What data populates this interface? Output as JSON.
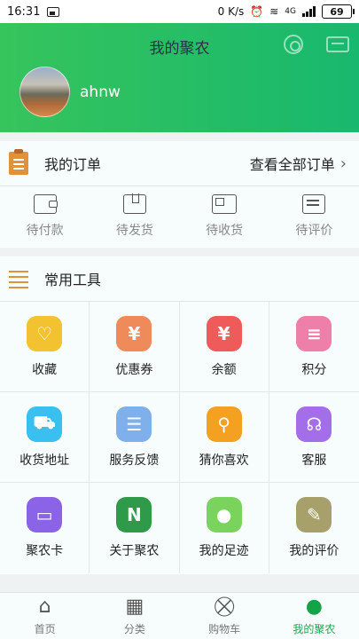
{
  "status_bar": {
    "time": "16:31",
    "net_speed": "0 K/s",
    "network": "4G",
    "battery": "69"
  },
  "header": {
    "title": "我的聚农",
    "username": "ahnw",
    "gradient_start": "#36c45c",
    "gradient_end": "#18b86e"
  },
  "orders": {
    "title": "我的订单",
    "view_all": "查看全部订单",
    "items": [
      {
        "label": "待付款",
        "icon": "wallet-icon"
      },
      {
        "label": "待发货",
        "icon": "box-icon"
      },
      {
        "label": "待收货",
        "icon": "truck-icon"
      },
      {
        "label": "待评价",
        "icon": "comment-icon"
      }
    ]
  },
  "tools": {
    "title": "常用工具",
    "items": [
      {
        "label": "收藏",
        "icon": "heart-icon",
        "color": "#f2c231",
        "glyph": "♡"
      },
      {
        "label": "优惠券",
        "icon": "coupon-icon",
        "color": "#ef8a5a",
        "glyph": "¥"
      },
      {
        "label": "余额",
        "icon": "money-bag-icon",
        "color": "#ef5b5b",
        "glyph": "¥"
      },
      {
        "label": "积分",
        "icon": "coins-icon",
        "color": "#ee7fa8",
        "glyph": "≡"
      },
      {
        "label": "收货地址",
        "icon": "delivery-truck-icon",
        "color": "#39c0f0",
        "glyph": "⛟"
      },
      {
        "label": "服务反馈",
        "icon": "clipboard-icon",
        "color": "#7fb0ec",
        "glyph": "☰"
      },
      {
        "label": "猜你喜欢",
        "icon": "magnifier-icon",
        "color": "#f4a020",
        "glyph": "⚲"
      },
      {
        "label": "客服",
        "icon": "headset-icon",
        "color": "#a46ee8",
        "glyph": "☊"
      },
      {
        "label": "聚农卡",
        "icon": "card-icon",
        "color": "#8a63e6",
        "glyph": "▭"
      },
      {
        "label": "关于聚农",
        "icon": "logo-icon",
        "color": "#2f9a49",
        "glyph": "N"
      },
      {
        "label": "我的足迹",
        "icon": "footprint-icon",
        "color": "#7ad35c",
        "glyph": "●"
      },
      {
        "label": "我的评价",
        "icon": "edit-icon",
        "color": "#a8a06a",
        "glyph": "✎"
      }
    ]
  },
  "tabbar": {
    "items": [
      {
        "label": "首页",
        "icon": "home-icon",
        "glyph": "⌂"
      },
      {
        "label": "分类",
        "icon": "category-icon",
        "glyph": "▦"
      },
      {
        "label": "购物车",
        "icon": "cart-icon",
        "glyph": "⛒"
      },
      {
        "label": "我的聚农",
        "icon": "profile-icon",
        "glyph": "●"
      }
    ],
    "active_color": "#1aa84f"
  }
}
